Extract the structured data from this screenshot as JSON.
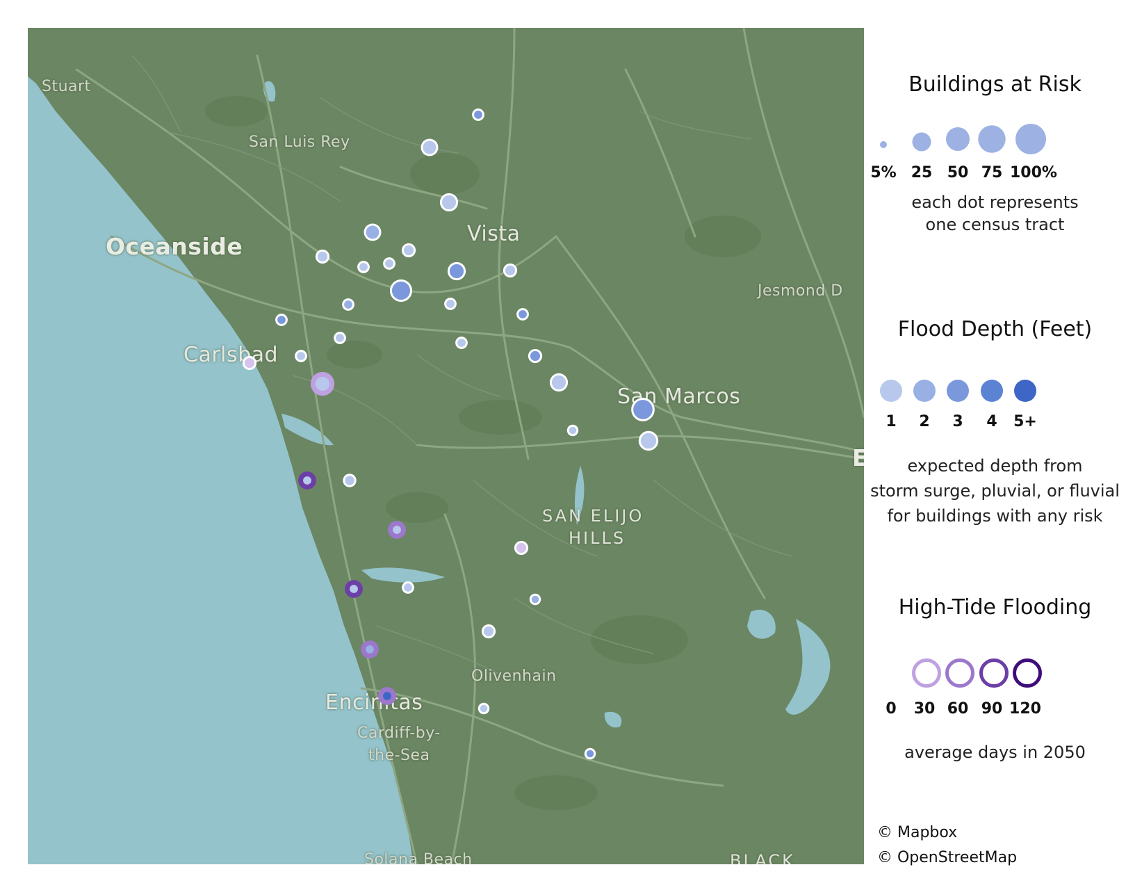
{
  "map": {
    "places": {
      "stuart": "Stuart",
      "san_luis_rey": "San Luis Rey",
      "oceanside": "Oceanside",
      "vista": "Vista",
      "jesmond": "Jesmond D",
      "carlsbad": "Carlsbad",
      "san_marcos": "San Marcos",
      "san_elijo_1": "SAN ELIJO",
      "san_elijo_2": "HILLS",
      "olivenhain": "Olivenhain",
      "encinitas": "Encinitas",
      "cardiff_1": "Cardiff-by-",
      "cardiff_2": "the-Sea",
      "solana_beach": "Solana Beach",
      "black": "BLACK",
      "e_edge": "E"
    },
    "colors": {
      "land": "#6b8663",
      "water": "#94c3cb",
      "road": "#8ea783"
    },
    "census_tracts": [
      {
        "risk_pct": 5,
        "depth_ft": 3,
        "tide_days": null
      },
      {
        "risk_pct": 25,
        "depth_ft": 1,
        "tide_days": null
      },
      {
        "risk_pct": 30,
        "depth_ft": 1,
        "tide_days": null
      },
      {
        "risk_pct": 25,
        "depth_ft": 2,
        "tide_days": null
      },
      {
        "risk_pct": 10,
        "depth_ft": 1,
        "tide_days": null
      },
      {
        "risk_pct": 10,
        "depth_ft": 1,
        "tide_days": null
      },
      {
        "risk_pct": 5,
        "depth_ft": 1,
        "tide_days": null
      },
      {
        "risk_pct": 5,
        "depth_ft": 1,
        "tide_days": null
      },
      {
        "risk_pct": 30,
        "depth_ft": 3,
        "tide_days": null
      },
      {
        "risk_pct": 10,
        "depth_ft": 1,
        "tide_days": null
      },
      {
        "risk_pct": 60,
        "depth_ft": 3,
        "tide_days": null
      },
      {
        "risk_pct": 5,
        "depth_ft": 2,
        "tide_days": null
      },
      {
        "risk_pct": 5,
        "depth_ft": 1,
        "tide_days": null
      },
      {
        "risk_pct": 5,
        "depth_ft": 3,
        "tide_days": null
      },
      {
        "risk_pct": 5,
        "depth_ft": 3,
        "tide_days": null
      },
      {
        "risk_pct": 5,
        "depth_ft": 1,
        "tide_days": null
      },
      {
        "risk_pct": 5,
        "depth_ft": 1,
        "tide_days": null
      },
      {
        "risk_pct": 10,
        "depth_ft": 3,
        "tide_days": null
      },
      {
        "risk_pct": 30,
        "depth_ft": 1,
        "tide_days": 30
      },
      {
        "risk_pct": 5,
        "depth_ft": 1,
        "tide_days": null
      },
      {
        "risk_pct": 10,
        "depth_ft": 4,
        "tide_days": 0
      },
      {
        "risk_pct": 30,
        "depth_ft": 1,
        "tide_days": null
      },
      {
        "risk_pct": 70,
        "depth_ft": 3,
        "tide_days": null
      },
      {
        "risk_pct": 3,
        "depth_ft": 1,
        "tide_days": null
      },
      {
        "risk_pct": 40,
        "depth_ft": 1,
        "tide_days": null
      },
      {
        "risk_pct": 5,
        "depth_ft": 1,
        "tide_days": 90
      },
      {
        "risk_pct": 8,
        "depth_ft": 1,
        "tide_days": null
      },
      {
        "risk_pct": 5,
        "depth_ft": 1,
        "tide_days": 60
      },
      {
        "risk_pct": 10,
        "depth_ft": 1,
        "tide_days": 0
      },
      {
        "risk_pct": 5,
        "depth_ft": 1,
        "tide_days": 0
      },
      {
        "risk_pct": 5,
        "depth_ft": 1,
        "tide_days": 90
      },
      {
        "risk_pct": 3,
        "depth_ft": 2,
        "tide_days": null
      },
      {
        "risk_pct": 10,
        "depth_ft": 1,
        "tide_days": null
      },
      {
        "risk_pct": 5,
        "depth_ft": 2,
        "tide_days": 60
      },
      {
        "risk_pct": 5,
        "depth_ft": 5,
        "tide_days": 60
      },
      {
        "risk_pct": 3,
        "depth_ft": 1,
        "tide_days": null
      },
      {
        "risk_pct": 3,
        "depth_ft": 3,
        "tide_days": 0
      }
    ]
  },
  "legend": {
    "risk": {
      "title": "Buildings at Risk",
      "labels": [
        "5%",
        "25",
        "50",
        "75",
        "100%"
      ],
      "values": [
        5,
        25,
        50,
        75,
        100
      ],
      "note_1": "each dot represents",
      "note_2": "one census tract",
      "color": "#9db1e3"
    },
    "depth": {
      "title": "Flood Depth (Feet)",
      "labels": [
        "1",
        "2",
        "3",
        "4",
        "5+"
      ],
      "colors": [
        "#b7c8ec",
        "#98b0e3",
        "#7b98dc",
        "#5c82d3",
        "#3e66c6"
      ],
      "note_1": "expected depth from",
      "note_2": "storm surge, pluvial, or fluvial",
      "note_3": "for buildings with any risk"
    },
    "tide": {
      "title": "High-Tide Flooding",
      "labels": [
        "0",
        "30",
        "60",
        "90",
        "120"
      ],
      "colors": [
        "#ffffff",
        "#bfa0e0",
        "#9b78cc",
        "#6c3fa6",
        "#3f0d7a"
      ],
      "note": "average days in 2050"
    }
  },
  "credits": {
    "mapbox": "© Mapbox",
    "osm": "© OpenStreetMap"
  }
}
